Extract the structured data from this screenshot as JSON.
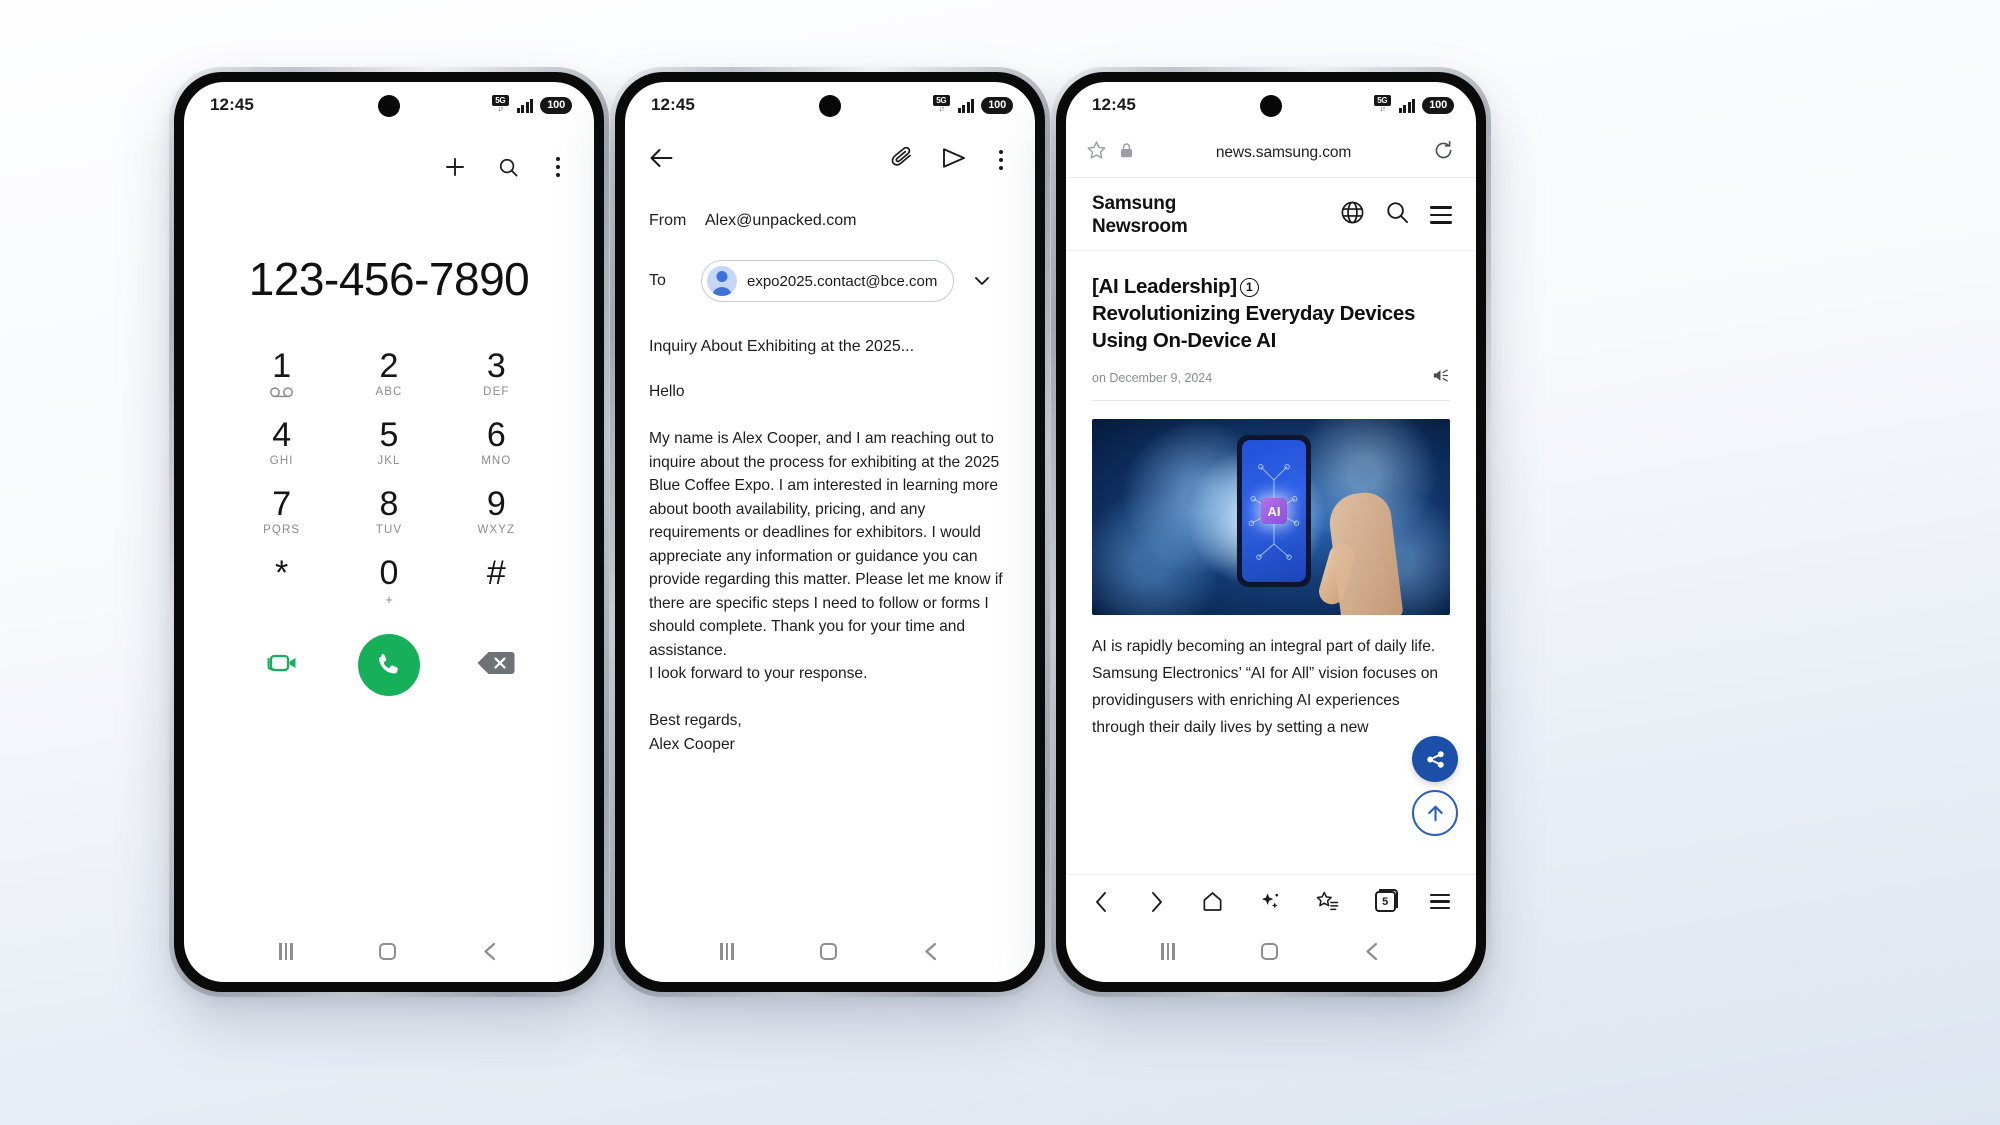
{
  "status_bar": {
    "time": "12:45",
    "network": "5G",
    "battery": "100",
    "icons": [
      "5g-icon",
      "signal-bars-icon",
      "battery-level-icon"
    ]
  },
  "nav_bar": {
    "recents": "recents-icon",
    "home": "home-icon",
    "back": "back-icon"
  },
  "dialer": {
    "app": "Phone Dialer",
    "toolbar": {
      "add": "plus-icon",
      "search": "search-icon",
      "more": "more-options-icon"
    },
    "number": "123-456-7890",
    "keys": [
      {
        "num": "1",
        "sub": "",
        "icon": "voicemail-icon"
      },
      {
        "num": "2",
        "sub": "ABC",
        "icon": ""
      },
      {
        "num": "3",
        "sub": "DEF",
        "icon": ""
      },
      {
        "num": "4",
        "sub": "GHI",
        "icon": ""
      },
      {
        "num": "5",
        "sub": "JKL",
        "icon": ""
      },
      {
        "num": "6",
        "sub": "MNO",
        "icon": ""
      },
      {
        "num": "7",
        "sub": "PQRS",
        "icon": ""
      },
      {
        "num": "8",
        "sub": "TUV",
        "icon": ""
      },
      {
        "num": "9",
        "sub": "WXYZ",
        "icon": ""
      },
      {
        "num": "*",
        "sub": "",
        "icon": ""
      },
      {
        "num": "0",
        "sub": "+",
        "icon": ""
      },
      {
        "num": "#",
        "sub": "",
        "icon": ""
      }
    ],
    "actions": {
      "video_call": "video-call-icon",
      "call": "call-icon",
      "backspace": "backspace-icon"
    },
    "colors": {
      "call_green": "#16b05a",
      "backspace_gray": "#6e7277"
    }
  },
  "email": {
    "app": "Email Compose",
    "toolbar": {
      "back": "back-arrow-icon",
      "attach": "attachment-icon",
      "send": "send-icon",
      "more": "more-options-icon"
    },
    "from_label": "From",
    "from_value": "Alex@unpacked.com",
    "to_label": "To",
    "to_value": "expo2025.contact@bce.com",
    "expand": "chevron-down-icon",
    "subject": "Inquiry About Exhibiting at the 2025...",
    "body": "Hello\n\nMy name is Alex Cooper, and I am reaching out to inquire about the process for exhibiting at the 2025 Blue Coffee Expo. I am interested in learning more about booth availability, pricing, and any requirements or deadlines for exhibitors. I would appreciate any information or guidance you can provide regarding this matter. Please let me know if there are specific steps I need to follow or forms I should complete. Thank you for your time and assistance.\nI look forward to your response.\n\nBest regards,\nAlex Cooper"
  },
  "browser": {
    "app": "Samsung Internet",
    "url": "news.samsung.com",
    "url_icons": {
      "bookmark": "star-outline-icon",
      "lock": "lock-icon",
      "refresh": "refresh-icon"
    },
    "site": {
      "brand_line1": "Samsung",
      "brand_line2": "Newsroom",
      "icons": {
        "language": "globe-icon",
        "search": "search-icon",
        "menu": "hamburger-menu-icon"
      }
    },
    "article": {
      "category": "[AI Leadership]",
      "number": "1",
      "headline": "Revolutionizing Everyday Devices Using On-Device AI",
      "byline": "on December 9, 2024",
      "listen": "audio-speaker-icon",
      "image_alt": "hand-holding-phone-with-ai-chip",
      "image_label": "AI",
      "body": "AI is rapidly becoming an integral part of daily life. Samsung Electronics’ “AI for All” vision focuses on providingusers with enriching AI experiences through their daily lives by setting a new"
    },
    "fab": {
      "share": "share-icon",
      "scroll_top": "scroll-to-top-icon"
    },
    "toolbar": {
      "back": "browser-back-icon",
      "forward": "browser-forward-icon",
      "home": "browser-home-icon",
      "ai": "ai-sparkle-icon",
      "bookmarks": "bookmarks-icon",
      "tabs_count": "5",
      "menu": "browser-menu-icon"
    },
    "colors": {
      "fab_blue": "#1b4fa8",
      "fab_outline_blue": "#2a5fc0"
    }
  }
}
